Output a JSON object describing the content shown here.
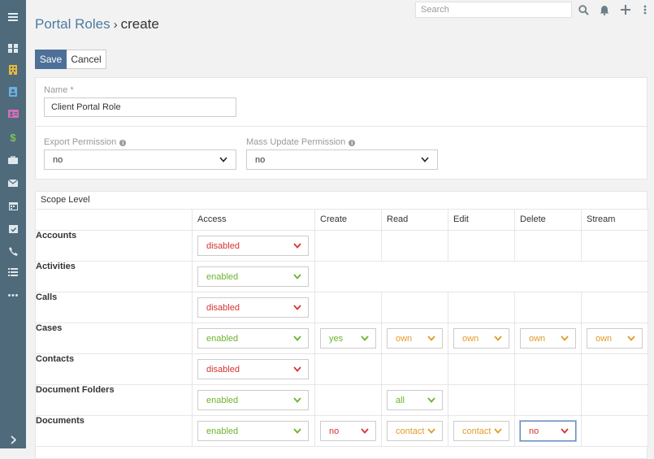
{
  "colors": {
    "sidebar": "#4e6a7b",
    "primary": "#4d7098",
    "link": "#4d7aa3",
    "enabled": "#6ab42d",
    "disabled": "#d63333",
    "own": "#e09c26",
    "all": "#6ab42d",
    "yes": "#6ab42d",
    "no": "#d63333",
    "contact": "#e09c26"
  },
  "sidebar": {
    "items": [
      {
        "name": "menu-icon"
      },
      {
        "name": "dashboard-icon"
      },
      {
        "name": "building-icon"
      },
      {
        "name": "contact-card-icon"
      },
      {
        "name": "id-card-icon"
      },
      {
        "name": "dollar-icon"
      },
      {
        "name": "briefcase-icon"
      },
      {
        "name": "envelope-icon"
      },
      {
        "name": "calendar-icon"
      },
      {
        "name": "calendar-check-icon"
      },
      {
        "name": "phone-icon"
      },
      {
        "name": "task-list-icon"
      },
      {
        "name": "more-icon"
      },
      {
        "name": "chevron-right-icon"
      }
    ]
  },
  "topbar": {
    "search_placeholder": "Search"
  },
  "header": {
    "breadcrumb": "Portal Roles",
    "separator": "›",
    "current": "create"
  },
  "buttons": {
    "save": "Save",
    "cancel": "Cancel"
  },
  "form": {
    "name_label": "Name *",
    "name_value": "Client Portal Role",
    "export_label": "Export Permission",
    "export_value": "no",
    "mass_update_label": "Mass Update Permission",
    "mass_update_value": "no"
  },
  "scope": {
    "heading": "Scope Level",
    "columns": [
      "Access",
      "Create",
      "Read",
      "Edit",
      "Delete",
      "Stream"
    ],
    "rows": [
      {
        "entity": "Accounts",
        "access": "disabled"
      },
      {
        "entity": "Activities",
        "access": "enabled"
      },
      {
        "entity": "Calls",
        "access": "disabled"
      },
      {
        "entity": "Cases",
        "access": "enabled",
        "create": "yes",
        "read": "own",
        "edit": "own",
        "delete": "own",
        "stream": "own"
      },
      {
        "entity": "Contacts",
        "access": "disabled"
      },
      {
        "entity": "Document Folders",
        "access": "enabled",
        "read": "all"
      },
      {
        "entity": "Documents",
        "access": "enabled",
        "create": "no",
        "read": "contact",
        "edit": "contact",
        "delete": "no"
      }
    ]
  }
}
